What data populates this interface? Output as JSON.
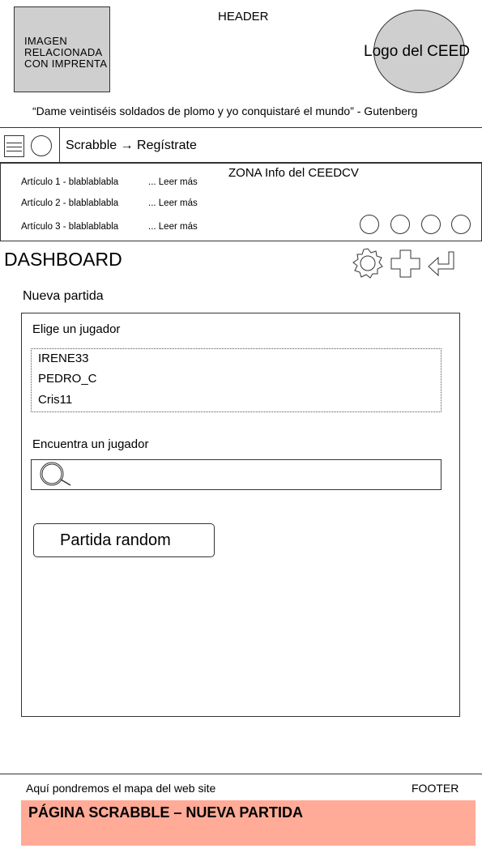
{
  "header": {
    "image_placeholder": [
      "IMAGEN",
      "RELACIONADA",
      "CON IMPRENTA"
    ],
    "label": "HEADER",
    "logo_text": "Logo del CEED",
    "quote": "“Dame veintiséis soldados de plomo y yo conquistaré el mundo”  - Gutenberg"
  },
  "nav": {
    "breadcrumb": "Scrabble → Regístrate"
  },
  "info": {
    "title": "ZONA Info del CEEDCV",
    "articles": [
      {
        "title": "Artículo 1 - blablablabla",
        "link": "... Leer más"
      },
      {
        "title": "Artículo 2 - blablablabla",
        "link": "... Leer más"
      },
      {
        "title": "Artículo 3 - blablablabla",
        "link": "... Leer más"
      }
    ],
    "social_icons": [
      "social-icon-1",
      "social-icon-2",
      "social-icon-3",
      "social-icon-4"
    ]
  },
  "dashboard": {
    "title": "DASHBOARD",
    "icons": [
      "gear-icon",
      "plus-icon",
      "return-icon"
    ]
  },
  "new_game": {
    "section_title": "Nueva partida",
    "choose_label": "Elige un jugador",
    "players": [
      "IRENE33",
      "PEDRO_C",
      "Cris11"
    ],
    "find_label": "Encuentra un jugador",
    "search_placeholder": "",
    "random_button": "Partida random"
  },
  "footer": {
    "sitemap": "Aquí pondremos el mapa del web site",
    "label": "FOOTER",
    "banner": "PÁGINA SCRABBLE – NUEVA PARTIDA",
    "banner_color": "#ffab97"
  }
}
